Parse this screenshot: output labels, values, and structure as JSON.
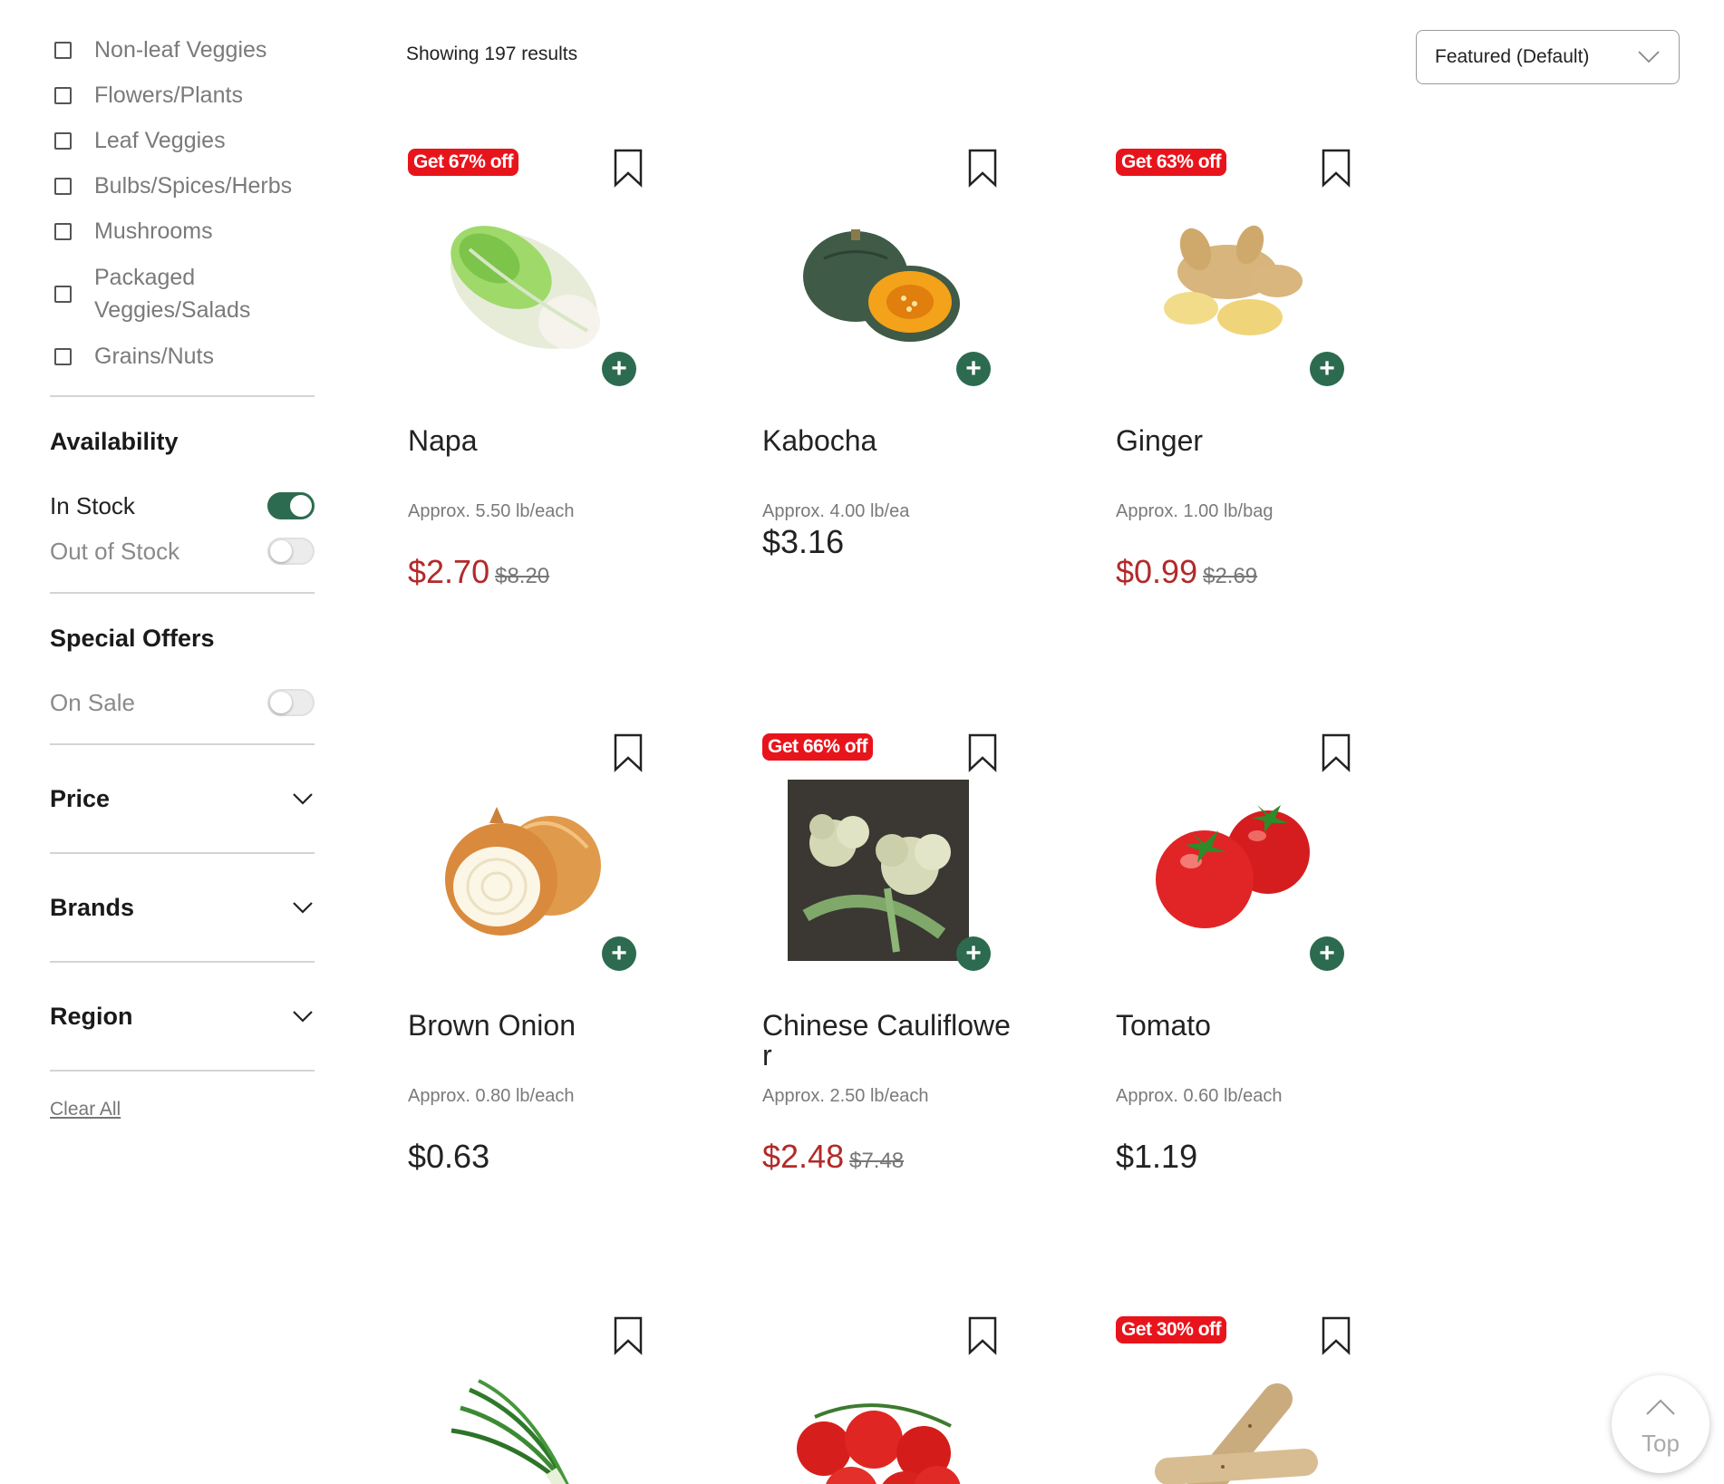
{
  "sidebar": {
    "categories": [
      {
        "label": "Non-leaf Veggies",
        "checked": false
      },
      {
        "label": "Flowers/Plants",
        "checked": false
      },
      {
        "label": "Leaf Veggies",
        "checked": false
      },
      {
        "label": "Bulbs/Spices/Herbs",
        "checked": false
      },
      {
        "label": "Mushrooms",
        "checked": false
      },
      {
        "label": "Packaged Veggies/Salads",
        "checked": false
      },
      {
        "label": "Grains/Nuts",
        "checked": false
      }
    ],
    "availability": {
      "title": "Availability",
      "in_stock": {
        "label": "In Stock",
        "on": true
      },
      "out_of_stock": {
        "label": "Out of Stock",
        "on": false
      }
    },
    "special_offers": {
      "title": "Special Offers",
      "on_sale": {
        "label": "On Sale",
        "on": false
      }
    },
    "filters": {
      "price": "Price",
      "brands": "Brands",
      "region": "Region"
    },
    "clear_all": "Clear All"
  },
  "toolbar": {
    "results": "Showing 197 results",
    "sort": "Featured (Default)"
  },
  "products": [
    {
      "badge": "Get 67% off",
      "name": "Napa",
      "approx": "Approx. 5.50 lb/each",
      "price": "$2.70",
      "old_price": "$8.20",
      "image": "napa-cabbage"
    },
    {
      "badge": "",
      "name": "Kabocha",
      "approx": "Approx. 4.00 lb/ea",
      "price": "$3.16",
      "old_price": "",
      "image": "kabocha-squash"
    },
    {
      "badge": "Get 63% off",
      "name": "Ginger",
      "approx": "Approx. 1.00 lb/bag",
      "price": "$0.99",
      "old_price": "$2.69",
      "image": "ginger-root"
    },
    {
      "badge": "",
      "name": "Brown Onion",
      "approx": "Approx. 0.80 lb/each",
      "price": "$0.63",
      "old_price": "",
      "image": "brown-onion"
    },
    {
      "badge": "Get 66% off",
      "name": "Chinese Cauliflower",
      "approx": "Approx. 2.50 lb/each",
      "price": "$2.48",
      "old_price": "$7.48",
      "image": "chinese-cauliflower"
    },
    {
      "badge": "",
      "name": "Tomato",
      "approx": "Approx. 0.60 lb/each",
      "price": "$1.19",
      "old_price": "",
      "image": "tomato"
    },
    {
      "badge": "",
      "name": "",
      "approx": "",
      "price": "",
      "old_price": "",
      "image": "green-onion"
    },
    {
      "badge": "",
      "name": "",
      "approx": "",
      "price": "",
      "old_price": "",
      "image": "cherry-tomatoes"
    },
    {
      "badge": "Get 30% off",
      "name": "",
      "approx": "",
      "price": "",
      "old_price": "",
      "image": "yam"
    }
  ],
  "back_to_top": "Top",
  "colors": {
    "brand_green": "#2c6b4f",
    "sale_red": "#b22a2a",
    "badge_red": "#e8141c"
  }
}
